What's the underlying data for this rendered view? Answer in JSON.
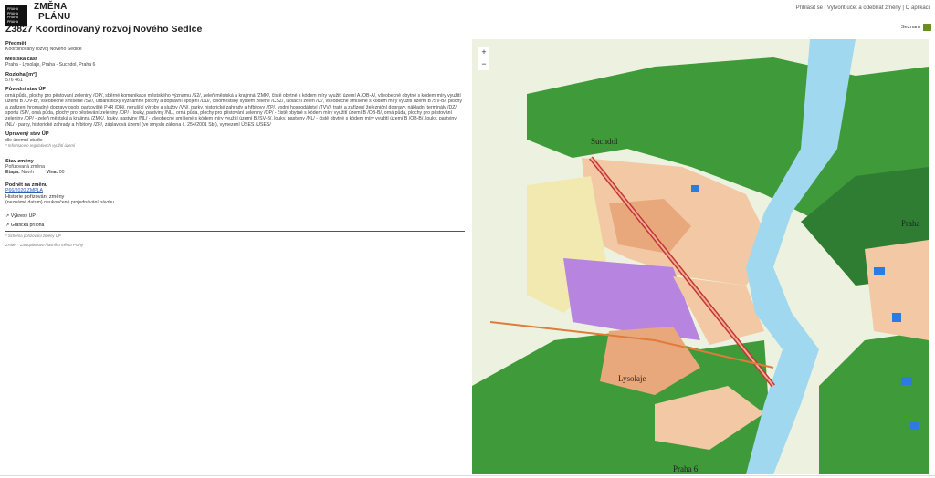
{
  "header": {
    "logo_lines": [
      "PRAHA",
      "PRAHA",
      "PRAHA",
      "PRAHA"
    ],
    "brand_line1": "ZMĚNA",
    "brand_line2": "PLÁNU",
    "title": "Z3827 Koordinovaný rozvoj Nového Sedlce",
    "links": {
      "login": "Přihlásit se",
      "sep1": " | ",
      "register": "Vytvořit účet a odebírat změny",
      "sep2": " | ",
      "about": "O aplikaci"
    }
  },
  "details": {
    "subject_label": "Předmět",
    "subject_value": "Koordinovaný rozvoj Nového Sedlce",
    "district_label": "Městská část",
    "district_value": "Praha - Lysolaje, Praha - Suchdol, Praha 6",
    "area_label": "Rozloha [m²]",
    "area_value": "576 461",
    "original_label": "Původní stav ÚP",
    "original_value": "orná půda, plochy pro pěstování zeleniny /OP/, sběrné komunikace městského významu /S2/, zeleň městská a krajinná /ZMK/, čistě obytné s kódem míry využití území A /OB-A/, všeobecně obytné s kódem míry využití území B /OV-B/, všeobecně smíšené /SV/, urbanisticky významné plochy a dopravní spojení /DU/, celoměstský systém zeleně /CSZ/, izolační zeleň /IZ/, všeobecně smíšené s kódem míry využití území B /SV-B/, plochy a zařízení hromadné dopravy osob, parkoviště P+R /DH/, nerušící výroby a služby /VN/, parky, historické zahrady a hřbitovy /ZP/, vodní hospodářství /TVV/, tratě a zařízení železniční dopravy, nákladní terminály /DZ/, sportu /SP/, orná půda, plochy pro pěstování zeleniny /OP/ - louky, pastviny /NL/, orná půda, plochy pro pěstování zeleniny /OP/ - čistě obytné s kódem míry využití území B /OB-B/, orná půda, plochy pro pěstování zeleniny /OP/ - zeleň městská a krajinná /ZMK/, louky, pastviny /NL/ - všeobecně smíšené s kódem míry využití území B /SV-B/, louky, pastviny /NL/ - čistě obytné s kódem míry využití území B /OB-B/, louky, pastviny /NL/ - parky, historické zahrady a hřbitovy /ZP/, záplavová území (ve smyslu zákona č. 254/2001 Sb.), vymezení ÚSES /USES/",
    "modified_label": "Upravený stav ÚP",
    "modified_value": "dle územní studie",
    "modified_note": "* Informace o regulativech využití území",
    "status_label": "Stav změny",
    "status_value": "Pořizovaná změna",
    "stage_label": "Etapa:",
    "stage_value": "Návrh",
    "wave_label": "Vlna:",
    "wave_value": "00",
    "initiator_label": "Podnět na změnu",
    "initiator_value": "P66/2020 ZMPLA",
    "history_label": "Historie pořizování změny",
    "history_value": "(neznámé datum) neukončené projednávání návrhu",
    "link_excerpt": "↗ Výkresy ÚP",
    "link_graphic": "↗ Grafická příloha",
    "foot_note1": "* Schéma pořizování změny ÚP",
    "foot_note2": "ZHMP - Zastupitelstvo hlavního města Prahy"
  },
  "map": {
    "list_button": "Seznam",
    "zoom_in": "+",
    "zoom_out": "−",
    "place_labels": [
      "Suchdol",
      "Lysolaje",
      "Praha",
      "Praha 6"
    ],
    "colors": {
      "base": "#e9f0d9",
      "park": "#3f9a3a",
      "forest": "#2e7d32",
      "meadow": "#9ccc65",
      "residential": "#f3c9a5",
      "mixed": "#e8a87c",
      "industry": "#b784e0",
      "river": "#9fd8ef",
      "road": "#c0392b",
      "water_blue": "#2d7be0"
    }
  }
}
